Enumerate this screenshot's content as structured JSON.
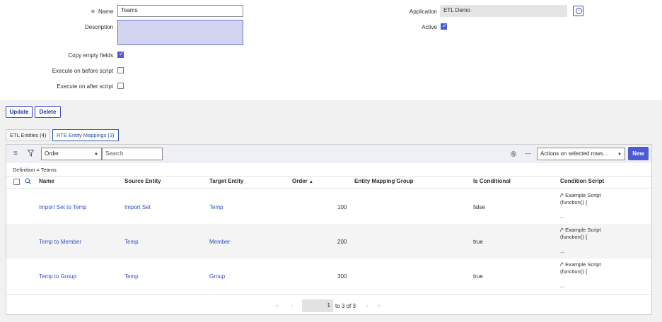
{
  "form": {
    "name_required_marker": "✳",
    "name_label": "Name",
    "name_value": "Teams",
    "description_label": "Description",
    "copy_empty_fields_label": "Copy empty fields",
    "execute_before_label": "Execute on before script",
    "execute_after_label": "Execute on after script",
    "application_label": "Application",
    "application_value": "ETL Demo",
    "active_label": "Active"
  },
  "actions": {
    "update": "Update",
    "delete": "Delete"
  },
  "tabs": [
    {
      "label": "ETL Entities (4)"
    },
    {
      "label": "RTE Entity Mappings (3)"
    }
  ],
  "toolbar": {
    "filter_field": "Order",
    "search_placeholder": "Search",
    "actions_select": "Actions on selected rows...",
    "new_button": "New"
  },
  "breadcrumb": "Definition = Teams",
  "table": {
    "headers": {
      "name": "Name",
      "source": "Source Entity",
      "target": "Target Entity",
      "order": "Order",
      "group": "Entity Mapping Group",
      "conditional": "Is Conditional",
      "script": "Condition Script"
    },
    "rows": [
      {
        "name": "Import Set to Temp",
        "source": "Import Set",
        "target": "Temp",
        "order": "100",
        "conditional": "false",
        "script1": "/* Example Script",
        "script2": "(function() {",
        "script3": "..."
      },
      {
        "name": "Temp to Member",
        "source": "Temp",
        "target": "Member",
        "order": "200",
        "conditional": "true",
        "script1": "/* Example Script",
        "script2": "(function() {",
        "script3": "..."
      },
      {
        "name": "Temp to Group",
        "source": "Temp",
        "target": "Group",
        "order": "300",
        "conditional": "true",
        "script1": "/* Example Script",
        "script2": "(function() {",
        "script3": "..."
      }
    ]
  },
  "pagination": {
    "current": "1",
    "range": "to 3 of 3"
  }
}
